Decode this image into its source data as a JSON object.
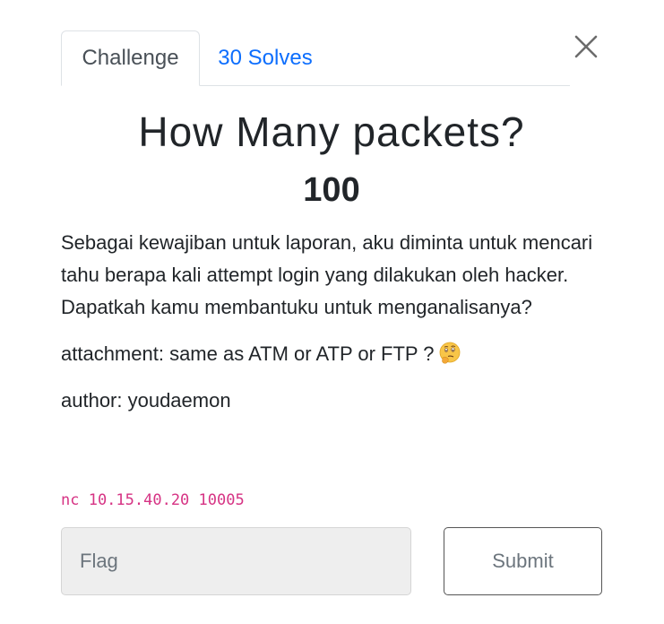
{
  "tabs": {
    "challenge_label": "Challenge",
    "solves_label": "30 Solves"
  },
  "challenge": {
    "title": "How Many packets?",
    "value": "100",
    "description": "Sebagai kewajiban untuk laporan, aku diminta untuk mencari tahu berapa kali attempt login yang dilakukan oleh hacker. Dapatkah kamu membantuku untuk menganalisanya?",
    "attachment": "attachment: same as ATM or ATP or FTP ?",
    "attachment_emoji": "thinking-face-icon",
    "author": "author: youdaemon",
    "connection": "nc 10.15.40.20 10005"
  },
  "form": {
    "flag_placeholder": "Flag",
    "submit_label": "Submit"
  },
  "colors": {
    "link": "#0d6efd",
    "code": "#d63384",
    "input_bg": "#eeeeee"
  }
}
